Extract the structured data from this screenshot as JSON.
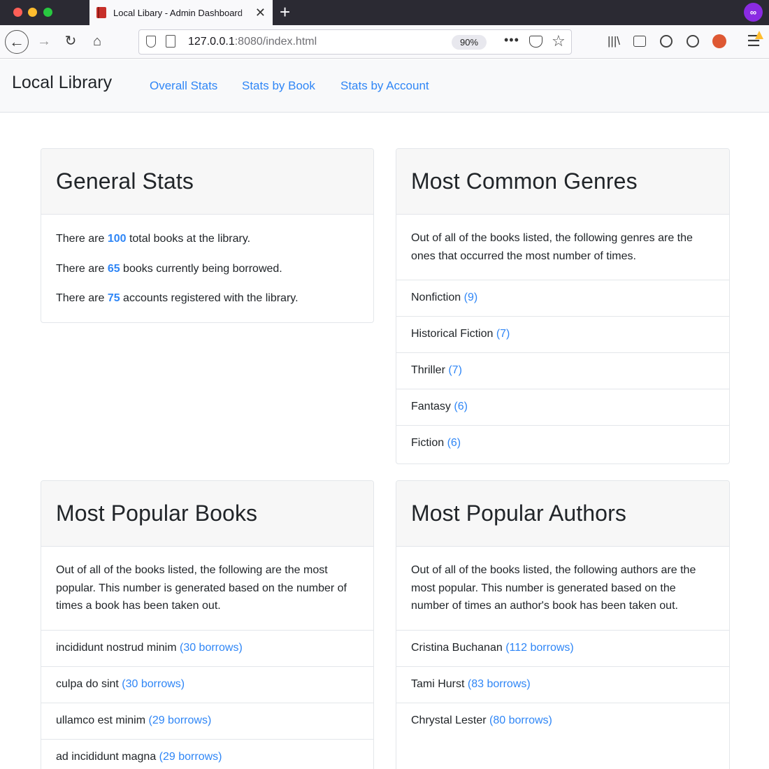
{
  "browser": {
    "tab_title": "Local Libary - Admin Dashboard",
    "url_host": "127.0.0.1",
    "url_rest": ":8080/index.html",
    "zoom": "90%",
    "new_tab_glyph": "+",
    "close_glyph": "✕",
    "more_glyph": "•••",
    "profile_badge": "∞",
    "icons": [
      "back-arrow-icon",
      "forward-arrow-icon",
      "reload-icon",
      "home-icon",
      "shield-icon",
      "page-icon",
      "pocket-icon",
      "star-icon",
      "library-icon",
      "sidebar-icon",
      "ublock-icon",
      "account-icon",
      "duckduckgo-icon",
      "menu-icon"
    ]
  },
  "navbar": {
    "brand": "Local Library",
    "links": [
      "Overall Stats",
      "Stats by Book",
      "Stats by Account"
    ]
  },
  "general_stats": {
    "title": "General Stats",
    "lines": [
      {
        "prefix": "There are ",
        "value": "100",
        "suffix": " total books at the library."
      },
      {
        "prefix": "There are ",
        "value": "65",
        "suffix": " books currently being borrowed."
      },
      {
        "prefix": "There are ",
        "value": "75",
        "suffix": " accounts registered with the library."
      }
    ]
  },
  "genres": {
    "title": "Most Common Genres",
    "description": "Out of all of the books listed, the following genres are the ones that occurred the most number of times.",
    "items": [
      {
        "name": "Nonfiction",
        "count": "(9)"
      },
      {
        "name": "Historical Fiction",
        "count": "(7)"
      },
      {
        "name": "Thriller",
        "count": "(7)"
      },
      {
        "name": "Fantasy",
        "count": "(6)"
      },
      {
        "name": "Fiction",
        "count": "(6)"
      }
    ]
  },
  "books": {
    "title": "Most Popular Books",
    "description": "Out of all of the books listed, the following are the most popular. This number is generated based on the number of times a book has been taken out.",
    "items": [
      {
        "name": "incididunt nostrud minim",
        "count": "(30 borrows)"
      },
      {
        "name": "culpa do sint",
        "count": "(30 borrows)"
      },
      {
        "name": "ullamco est minim",
        "count": "(29 borrows)"
      },
      {
        "name": "ad incididunt magna",
        "count": "(29 borrows)"
      }
    ]
  },
  "authors": {
    "title": "Most Popular Authors",
    "description": "Out of all of the books listed, the following authors are the most popular. This number is generated based on the number of times an author's book has been taken out.",
    "items": [
      {
        "name": "Cristina Buchanan",
        "count": "(112 borrows)"
      },
      {
        "name": "Tami Hurst",
        "count": "(83 borrows)"
      },
      {
        "name": "Chrystal Lester",
        "count": "(80 borrows)"
      }
    ]
  },
  "colors": {
    "link": "#2f86f6",
    "text": "#212529",
    "navbar_bg": "#f8f9fa",
    "card_header_bg": "#f7f7f7",
    "browser_chrome": "#2b2a33"
  }
}
